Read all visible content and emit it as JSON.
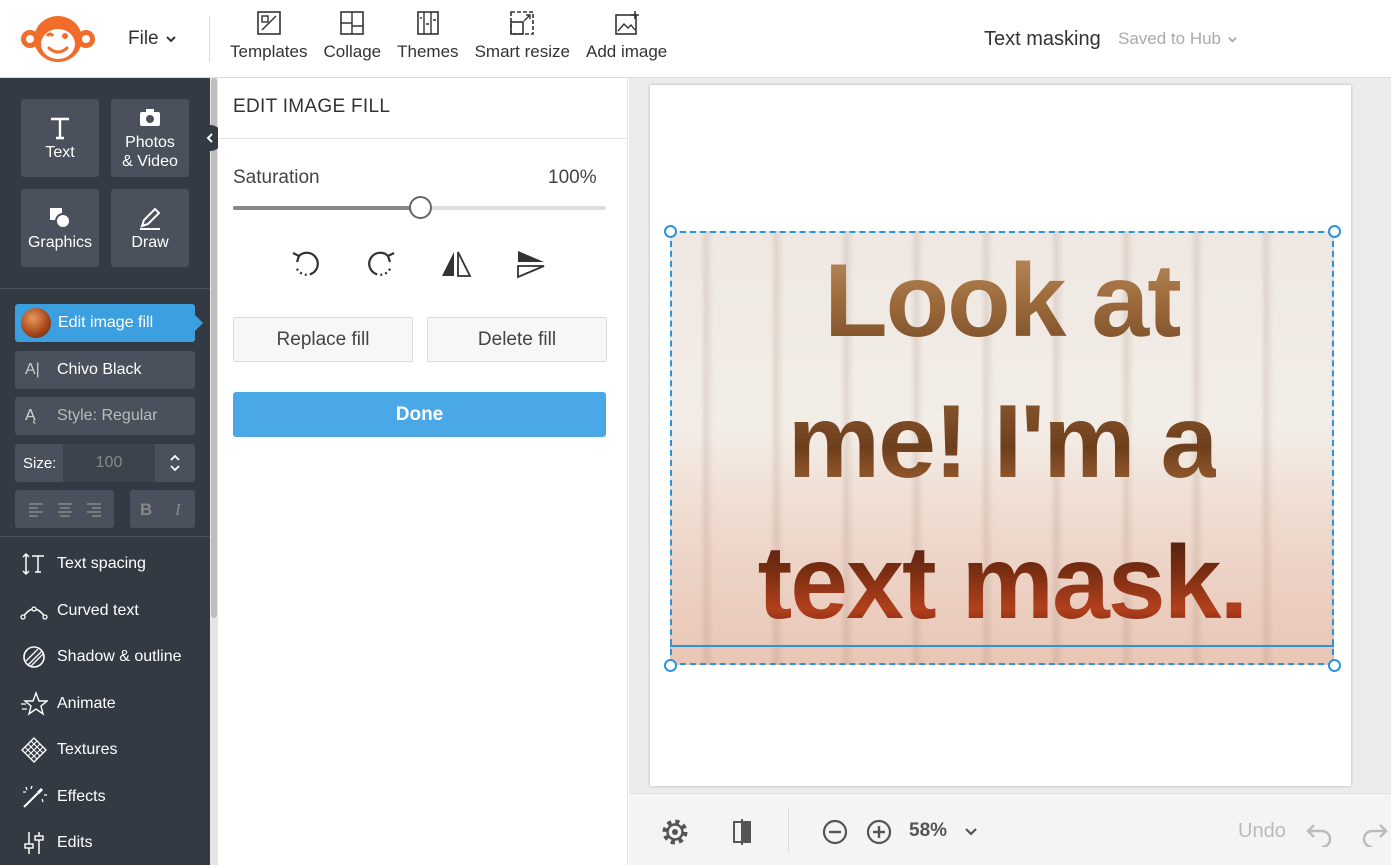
{
  "header": {
    "file_label": "File",
    "toolbar": [
      {
        "label": "Templates",
        "icon": "templates-icon"
      },
      {
        "label": "Collage",
        "icon": "collage-icon"
      },
      {
        "label": "Themes",
        "icon": "themes-icon"
      },
      {
        "label": "Smart resize",
        "icon": "smart-resize-icon"
      },
      {
        "label": "Add image",
        "icon": "add-image-icon"
      }
    ],
    "doc_title": "Text masking",
    "save_status": "Saved to Hub"
  },
  "sidebar": {
    "tiles": [
      {
        "label": "Text",
        "icon": "text-icon"
      },
      {
        "label": "Photos\n& Video",
        "icon": "camera-icon"
      },
      {
        "label": "Graphics",
        "icon": "graphics-icon"
      },
      {
        "label": "Draw",
        "icon": "pencil-icon"
      }
    ],
    "edit_fill_label": "Edit image fill",
    "font_name": "Chivo Black",
    "style_label": "Style: Regular",
    "size_label": "Size:",
    "size_value": "100",
    "menu": [
      {
        "label": "Text spacing",
        "icon": "text-spacing-icon"
      },
      {
        "label": "Curved text",
        "icon": "curved-text-icon"
      },
      {
        "label": "Shadow & outline",
        "icon": "shadow-outline-icon"
      },
      {
        "label": "Animate",
        "icon": "animate-star-icon"
      },
      {
        "label": "Textures",
        "icon": "textures-icon"
      },
      {
        "label": "Effects",
        "icon": "effects-wand-icon"
      },
      {
        "label": "Edits",
        "icon": "edits-sliders-icon"
      }
    ]
  },
  "panel": {
    "title": "EDIT IMAGE FILL",
    "saturation_label": "Saturation",
    "saturation_value": "100%",
    "saturation_level": 0.5,
    "replace_label": "Replace fill",
    "delete_label": "Delete fill",
    "done_label": "Done"
  },
  "canvas": {
    "lines": [
      "Look at",
      "me! I'm a",
      "text mask."
    ]
  },
  "footer": {
    "zoom": "58%",
    "undo_label": "Undo"
  },
  "colors": {
    "accent": "#49a8e5",
    "sidebar_bg": "#333a44",
    "selection": "#2b95dc",
    "logo": "#f26c2a"
  }
}
